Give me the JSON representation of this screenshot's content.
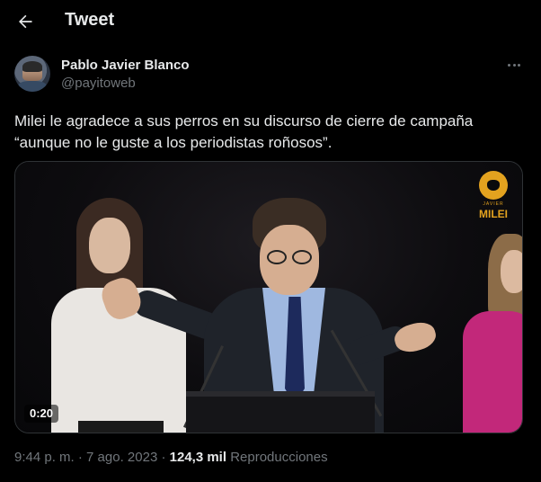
{
  "header": {
    "title": "Tweet",
    "back_icon": "arrow-left-icon"
  },
  "author": {
    "name": "Pablo Javier Blanco",
    "handle": "@payitoweb",
    "more_icon": "more-horizontal-icon"
  },
  "tweet": {
    "text_line1": "Milei le agradece a sus perros en su discurso de cierre de campaña",
    "text_line2": "“aunque no le guste a los periodistas roñosos”."
  },
  "media": {
    "type": "video",
    "timecode": "0:20",
    "watermark_sub": "JAVIER",
    "watermark_text": "MILEI"
  },
  "meta": {
    "time": "9:44 p. m.",
    "separator1": "·",
    "date": "7 ago. 2023",
    "separator2": "·",
    "views_count": "124,3 mil",
    "views_label": "Reproducciones"
  },
  "colors": {
    "background": "#000000",
    "text_primary": "#e7e9ea",
    "text_secondary": "#71767b",
    "border": "#2f3336",
    "watermark": "#e3a21f"
  }
}
